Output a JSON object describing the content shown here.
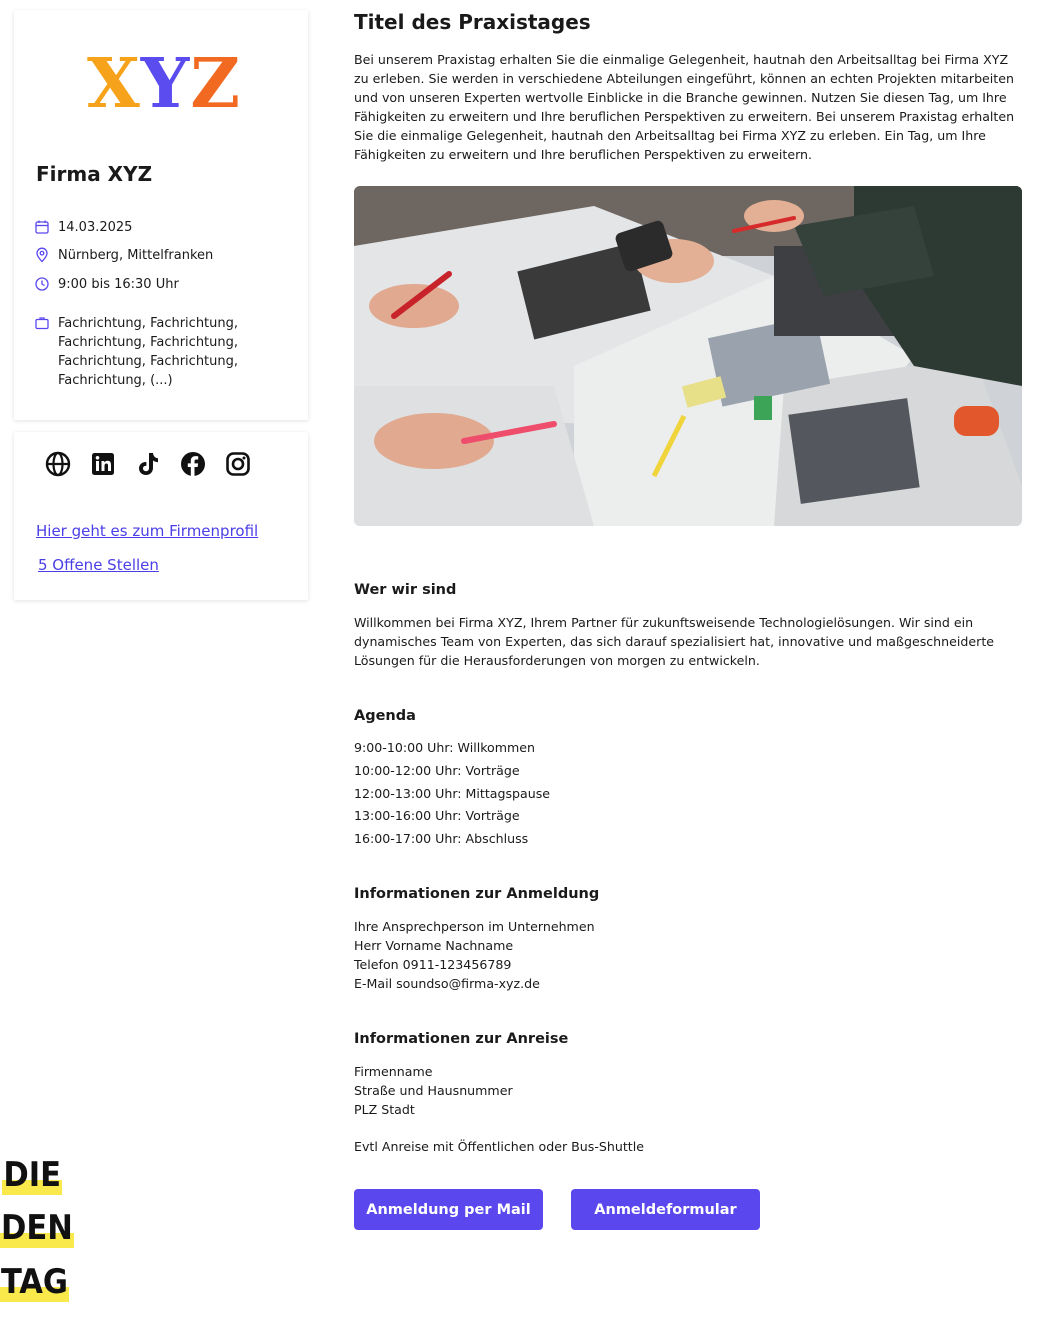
{
  "sidebar": {
    "logo": {
      "x": "X",
      "y": "Y",
      "z": "Z"
    },
    "company_name": "Firma XYZ",
    "date": "14.03.2025",
    "location": "Nürnberg, Mittelfranken",
    "time": "9:00 bis 16:30 Uhr",
    "fields": "Fachrichtung, Fachrichtung, Fachrichtung, Fachrichtung, Fachrichtung, Fachrichtung, Fachrichtung, (...)",
    "socials": [
      "globe-icon",
      "linkedin-icon",
      "tiktok-icon",
      "facebook-icon",
      "instagram-icon"
    ],
    "profile_link": "Hier geht es zum Firmenprofil",
    "jobs_link": "5 Offene Stellen"
  },
  "main": {
    "title": "Titel des Praxistages",
    "intro": "Bei unserem Praxistag erhalten Sie die einmalige Gelegenheit, hautnah den Arbeitsalltag bei Firma XYZ zu erleben. Sie werden in verschiedene Abteilungen eingeführt, können an echten Projekten mitarbeiten und von unseren Experten wertvolle Einblicke in die Branche gewinnen. Nutzen Sie diesen Tag, um Ihre Fähigkeiten zu erweitern und Ihre beruflichen Perspektiven zu erweitern. Bei unserem Praxistag erhalten Sie die einmalige Gelegenheit, hautnah den Arbeitsalltag bei Firma XYZ zu erleben. Ein Tag, um Ihre Fähigkeiten zu erweitern und Ihre beruflichen Perspektiven zu erweitern.",
    "about_heading": "Wer wir sind",
    "about_text": "Willkommen bei Firma XYZ, Ihrem Partner für zukunftsweisende Technologielösungen. Wir sind ein dynamisches Team von Experten, das sich darauf spezialisiert hat, innovative und maßgeschneiderte Lösungen für die Herausforderungen von morgen zu entwickeln.",
    "agenda_heading": "Agenda",
    "agenda": [
      "9:00-10:00 Uhr: Willkommen",
      "10:00-12:00 Uhr: Vorträge",
      "12:00-13:00 Uhr: Mittagspause",
      "13:00-16:00 Uhr: Vorträge",
      "16:00-17:00 Uhr: Abschluss"
    ],
    "registration_heading": "Informationen zur Anmeldung",
    "registration_lines": [
      "Ihre Ansprechperson im Unternehmen",
      "Herr Vorname Nachname",
      "Telefon 0911-123456789",
      "E-Mail soundso@firma-xyz.de"
    ],
    "travel_heading": "Informationen zur Anreise",
    "travel_lines": [
      "Firmenname",
      "Straße und Hausnummer",
      "PLZ Stadt"
    ],
    "travel_note": "Evtl Anreise mit Öffentlichen oder Bus-Shuttle",
    "btn_mail": "Anmeldung per Mail",
    "btn_form": "Anmeldeformular"
  },
  "overlay": [
    "DIE",
    "DEN",
    "TAG"
  ],
  "colors": {
    "accent": "#5a48ee",
    "link": "#4a3ee6",
    "highlight": "#f9e94a",
    "logo_x": "#f7a21b",
    "logo_y": "#5b4cf0",
    "logo_z": "#f26a22"
  }
}
